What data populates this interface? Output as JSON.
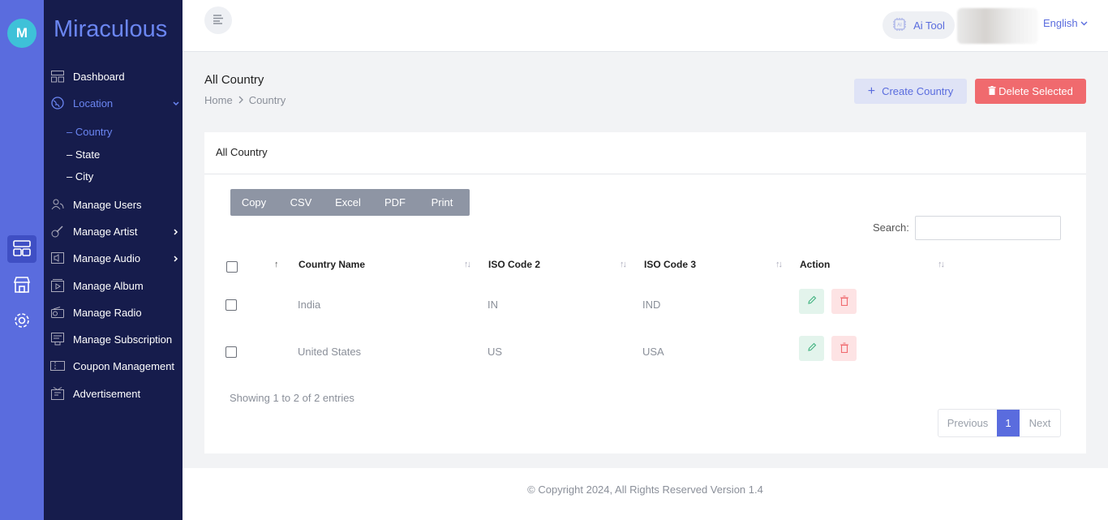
{
  "brand": {
    "logo_letter": "M",
    "name": "Miraculous"
  },
  "rail": {
    "items": [
      "grid-icon",
      "store-icon",
      "gear-icon"
    ]
  },
  "sidebar": {
    "items": [
      {
        "label": "Dashboard",
        "icon": "dashboard-icon"
      },
      {
        "label": "Location",
        "icon": "globe-icon"
      },
      {
        "label": "Manage Users",
        "icon": "users-icon"
      },
      {
        "label": "Manage Artist",
        "icon": "guitar-icon"
      },
      {
        "label": "Manage Audio",
        "icon": "audio-icon"
      },
      {
        "label": "Manage Album",
        "icon": "album-icon"
      },
      {
        "label": "Manage Radio",
        "icon": "radio-icon"
      },
      {
        "label": "Manage Subscription",
        "icon": "subscription-icon"
      },
      {
        "label": "Coupon Management",
        "icon": "coupon-icon"
      },
      {
        "label": "Advertisement",
        "icon": "advertisement-icon"
      }
    ],
    "location_sub": [
      "– Country",
      "– State",
      "– City"
    ]
  },
  "topbar": {
    "ai_tool": "Ai Tool",
    "language": "English"
  },
  "page": {
    "title": "All Country",
    "breadcrumb": [
      "Home",
      "Country"
    ],
    "create_btn": "Create Country",
    "delete_btn": "Delete Selected"
  },
  "card": {
    "title": "All Country",
    "export_buttons": [
      "Copy",
      "CSV",
      "Excel",
      "PDF",
      "Print"
    ],
    "search_label": "Search:",
    "columns": [
      "Country Name",
      "ISO Code 2",
      "ISO Code 3",
      "Action"
    ],
    "rows": [
      {
        "name": "India",
        "iso2": "IN",
        "iso3": "IND"
      },
      {
        "name": "United States",
        "iso2": "US",
        "iso3": "USA"
      }
    ],
    "info": "Showing 1 to 2 of 2 entries",
    "pager": {
      "prev": "Previous",
      "current": "1",
      "next": "Next"
    }
  },
  "footer": "© Copyright 2024, All Rights Reserved Version 1.4",
  "colors": {
    "accent": "#5a6cde",
    "sidebar": "#161c4c",
    "danger": "#f06a6e",
    "success": "#3fb27f"
  }
}
